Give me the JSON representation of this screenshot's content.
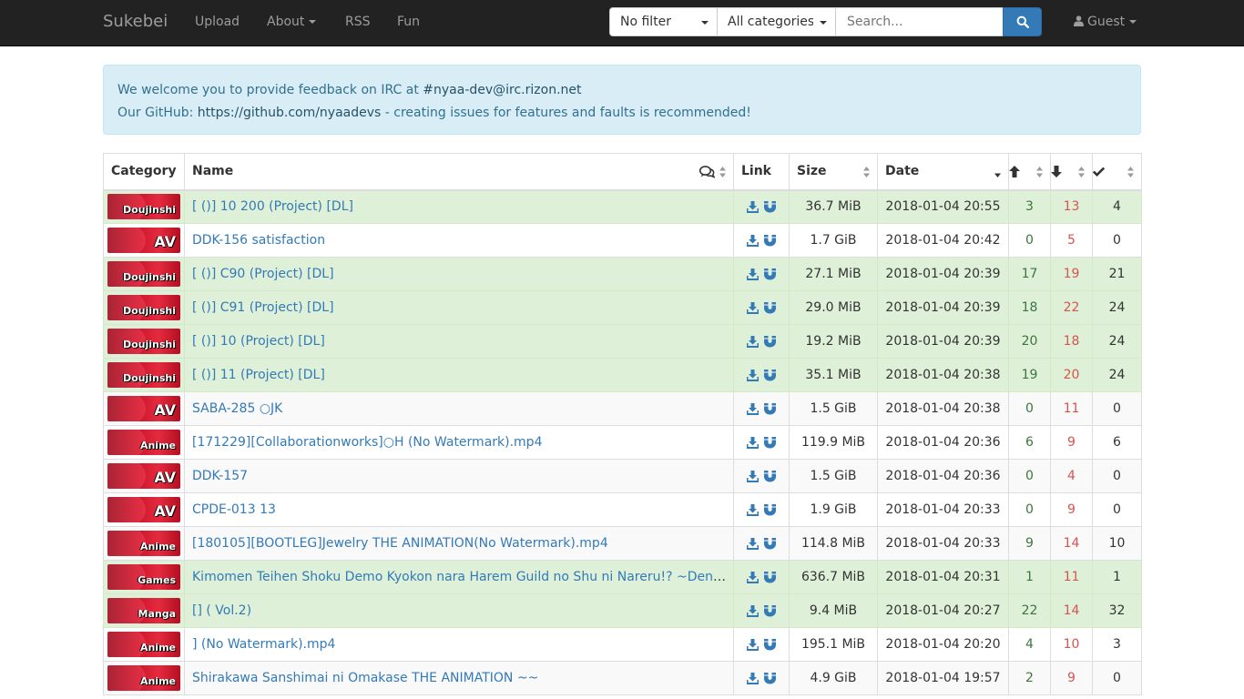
{
  "navbar": {
    "brand": "Sukebei",
    "items": [
      {
        "label": "Upload",
        "dropdown": false
      },
      {
        "label": "About",
        "dropdown": true
      },
      {
        "label": "RSS",
        "dropdown": false
      },
      {
        "label": "Fun",
        "dropdown": false
      }
    ],
    "filter": "No filter",
    "category": "All categories",
    "search_placeholder": "Search...",
    "user": "Guest",
    "icons": {
      "search": "search-icon",
      "user": "user-icon"
    }
  },
  "alert": {
    "line1_prefix": "We welcome you to provide feedback on IRC at ",
    "line1_link": "#nyaa-dev@irc.rizon.net",
    "line2_prefix": "Our GitHub: ",
    "line2_link": "https://github.com/nyaadevs",
    "line2_suffix": " - creating issues for features and faults is recommended!"
  },
  "table": {
    "headers": {
      "category": "Category",
      "name": "Name",
      "link": "Link",
      "size": "Size",
      "date": "Date"
    },
    "rows": [
      {
        "cat": "Doujinshi",
        "name": "[ ()] 10 200 (Project) [DL]",
        "size": "36.7 MiB",
        "date": "2018-01-04 20:55",
        "seed": "3",
        "leech": "13",
        "done": "4",
        "trusted": true
      },
      {
        "cat": "AV",
        "name": "DDK-156 satisfaction",
        "size": "1.7 GiB",
        "date": "2018-01-04 20:42",
        "seed": "0",
        "leech": "5",
        "done": "0",
        "trusted": false
      },
      {
        "cat": "Doujinshi",
        "name": "[ ()] C90  (Project) [DL]",
        "size": "27.1 MiB",
        "date": "2018-01-04 20:39",
        "seed": "17",
        "leech": "19",
        "done": "21",
        "trusted": true
      },
      {
        "cat": "Doujinshi",
        "name": "[ ()] C91  (Project) [DL]",
        "size": "29.0 MiB",
        "date": "2018-01-04 20:39",
        "seed": "18",
        "leech": "22",
        "done": "24",
        "trusted": true
      },
      {
        "cat": "Doujinshi",
        "name": "[ ()] 10  (Project) [DL]",
        "size": "19.2 MiB",
        "date": "2018-01-04 20:39",
        "seed": "20",
        "leech": "18",
        "done": "24",
        "trusted": true
      },
      {
        "cat": "Doujinshi",
        "name": "[ ()] 11  (Project) [DL]",
        "size": "35.1 MiB",
        "date": "2018-01-04 20:38",
        "seed": "19",
        "leech": "20",
        "done": "24",
        "trusted": true
      },
      {
        "cat": "AV",
        "name": "SABA-285  ○JK",
        "size": "1.5 GiB",
        "date": "2018-01-04 20:38",
        "seed": "0",
        "leech": "11",
        "done": "0",
        "trusted": false
      },
      {
        "cat": "Anime",
        "name": "[171229][Collaborationworks]○H (No Watermark).mp4",
        "size": "119.9 MiB",
        "date": "2018-01-04 20:36",
        "seed": "6",
        "leech": "9",
        "done": "6",
        "trusted": false
      },
      {
        "cat": "AV",
        "name": "DDK-157",
        "size": "1.5 GiB",
        "date": "2018-01-04 20:36",
        "seed": "0",
        "leech": "4",
        "done": "0",
        "trusted": false
      },
      {
        "cat": "AV",
        "name": "CPDE-013 13",
        "size": "1.9 GiB",
        "date": "2018-01-04 20:33",
        "seed": "0",
        "leech": "9",
        "done": "0",
        "trusted": false
      },
      {
        "cat": "Anime",
        "name": "[180105][BOOTLEG]Jewelry THE ANIMATION(No Watermark).mp4",
        "size": "114.8 MiB",
        "date": "2018-01-04 20:33",
        "seed": "9",
        "leech": "14",
        "done": "10",
        "trusted": false
      },
      {
        "cat": "Games",
        "name": "Kimomen Teihen Shoku Demo Kyokon nara Harem Guild no Shu ni Nareru!? ~Densetsu no Kyokon de Teihen Heroine Tachi o Kaikai shite Ore no Jinsei Shoubu~",
        "size": "636.7 MiB",
        "date": "2018-01-04 20:31",
        "seed": "1",
        "leech": "11",
        "done": "1",
        "trusted": true
      },
      {
        "cat": "Manga",
        "name": "[]   (  Vol.2)",
        "size": "9.4 MiB",
        "date": "2018-01-04 20:27",
        "seed": "22",
        "leech": "14",
        "done": "32",
        "trusted": true
      },
      {
        "cat": "Anime",
        "name": "]  (No Watermark).mp4",
        "size": "195.1 MiB",
        "date": "2018-01-04 20:20",
        "seed": "4",
        "leech": "10",
        "done": "3",
        "trusted": false
      },
      {
        "cat": "Anime",
        "name": "Shirakawa Sanshimai ni Omakase  THE ANIMATION ~~",
        "size": "4.9 GiB",
        "date": "2018-01-04 19:57",
        "seed": "2",
        "leech": "9",
        "done": "0",
        "trusted": false
      }
    ]
  },
  "colors": {
    "trusted_row": "#dff0d8",
    "link": "#337ab7",
    "seeders": "#3c763d",
    "leechers": "#d9534f"
  }
}
